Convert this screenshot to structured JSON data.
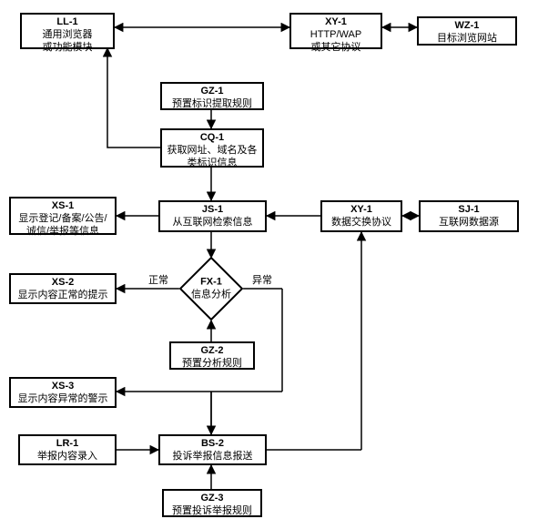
{
  "nodes": {
    "ll1": {
      "code": "LL-1",
      "text": "通用浏览器\n或功能模块"
    },
    "xy1a": {
      "code": "XY-1",
      "text": "HTTP/WAP\n或其它协议"
    },
    "wz1": {
      "code": "WZ-1",
      "text": "目标浏览网站"
    },
    "gz1": {
      "code": "GZ-1",
      "text": "预置标识提取规则"
    },
    "cq1": {
      "code": "CQ-1",
      "text": "获取网址、域名及各\n类标识信息"
    },
    "xs1": {
      "code": "XS-1",
      "text": "显示登记/备案/公告/\n诚信/举报等信息"
    },
    "js1": {
      "code": "JS-1",
      "text": "从互联网检索信息"
    },
    "xy1b": {
      "code": "XY-1",
      "text": "数据交换协议"
    },
    "sj1": {
      "code": "SJ-1",
      "text": "互联网数据源"
    },
    "fx1": {
      "code": "FX-1",
      "text": "信息分析"
    },
    "xs2": {
      "code": "XS-2",
      "text": "显示内容正常的提示"
    },
    "gz2": {
      "code": "GZ-2",
      "text": "预置分析规则"
    },
    "xs3": {
      "code": "XS-3",
      "text": "显示内容异常的警示"
    },
    "lr1": {
      "code": "LR-1",
      "text": "举报内容录入"
    },
    "bs2": {
      "code": "BS-2",
      "text": "投诉举报信息报送"
    },
    "gz3": {
      "code": "GZ-3",
      "text": "预置投诉举报规则"
    }
  },
  "edge_labels": {
    "normal": "正常",
    "abnormal": "异常"
  }
}
